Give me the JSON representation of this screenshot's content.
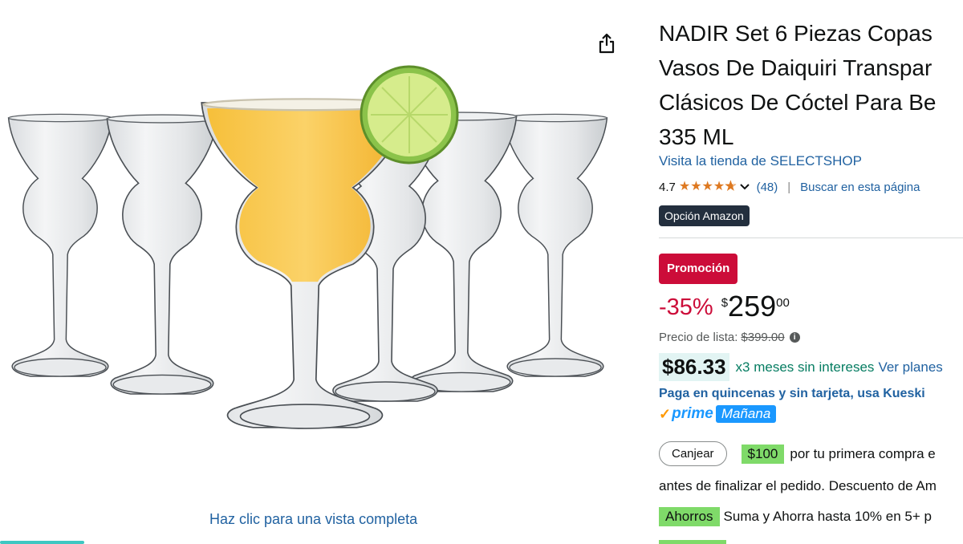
{
  "product": {
    "title_lines": [
      "NADIR Set 6 Piezas Copas",
      "Vasos De Daiquiri Transpar",
      "Clásicos De Cóctel Para Be",
      "335 ML"
    ],
    "store_link": "Visita la tienda de SELECTSHOP",
    "rating": "4.7",
    "rating_stars": 4.7,
    "review_count": "(48)",
    "search_link": "Buscar en esta página",
    "choice_badge": "Opción Amazon"
  },
  "pricing": {
    "promo_badge": "Promoción",
    "discount": "-35%",
    "currency_symbol": "$",
    "price_whole": "259",
    "price_cents": "00",
    "list_price_label": "Precio de lista:",
    "list_price": "$399.00",
    "installment_price": "$86.33",
    "installment_text": "x3 meses sin intereses",
    "installment_link": "Ver planes",
    "kueski_text": "Paga en quincenas y sin tarjeta, usa Kueski",
    "prime_label": "prime",
    "delivery_label": "Mañana"
  },
  "coupon": {
    "redeem_label": "Canjear",
    "amount": "$100",
    "text": "por tu primera compra e",
    "line2": "antes de finalizar el pedido. Descuento de Am"
  },
  "savings": {
    "badge": "Ahorros",
    "text": "Suma y Ahorra hasta 10% en 5+ p"
  },
  "gallery": {
    "view_link": "Haz clic para una vista completa"
  },
  "colors": {
    "link": "#2162a1",
    "promo_red": "#cc0c39",
    "prime_blue": "#1a98ff",
    "savings_green": "#7fda69",
    "installment_green": "#067d62"
  },
  "icons": {
    "share": "share-icon",
    "info": "info-icon",
    "check": "check-icon",
    "chevron": "chevron-down-icon"
  }
}
